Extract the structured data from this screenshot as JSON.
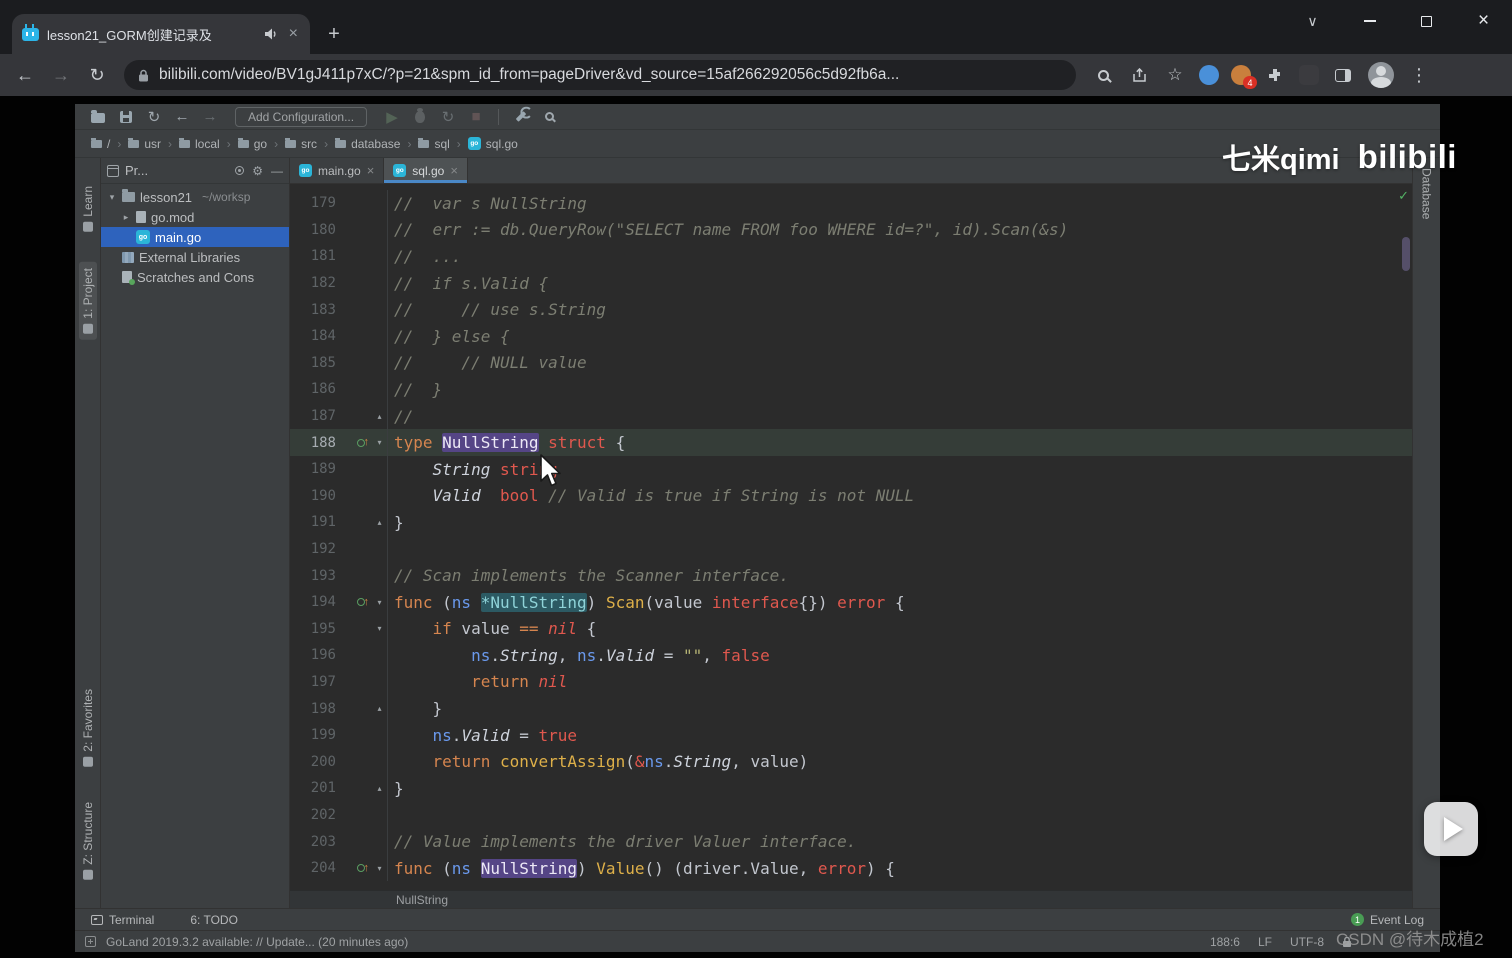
{
  "glyphs": {
    "close": "×",
    "plus": "+",
    "back": "←",
    "forward": "→",
    "reload": "↻",
    "chevron_down": "∨",
    "star": "☆",
    "menu": "⋮",
    "run": "▶",
    "stop": "■",
    "gear": "⚙",
    "minus": "—",
    "check": "✓",
    "up": "↑",
    "fold_open": "▾",
    "fold_close": "▴",
    "tree_open": "▾",
    "tree_closed": "▸",
    "sep": "›"
  },
  "browser": {
    "tab": {
      "title": "lesson21_GORM创建记录及"
    },
    "url": "bilibili.com/video/BV1gJ411p7xC/?p=21&spm_id_from=pageDriver&vd_source=15af266292056c5d92fb6a...",
    "extension_badge": "4"
  },
  "ide": {
    "toolbar": {
      "add_configuration": "Add Configuration..."
    },
    "breadcrumbs": [
      "/",
      "usr",
      "local",
      "go",
      "src",
      "database",
      "sql",
      "sql.go"
    ],
    "left_stripe": {
      "top": [
        {
          "label": "Learn"
        },
        {
          "label": "1: Project",
          "active": true
        }
      ],
      "bottom": [
        {
          "label": "2: Favorites"
        },
        {
          "label": "Z: Structure"
        }
      ]
    },
    "right_stripe": {
      "label": "Database"
    },
    "project": {
      "header": "Pr...",
      "items": [
        {
          "label": "lesson21",
          "suffix": "~/worksp",
          "arrow": "open",
          "icon": "folder",
          "indent": 0
        },
        {
          "label": "go.mod",
          "arrow": "closed",
          "icon": "file",
          "indent": 1
        },
        {
          "label": "main.go",
          "icon": "go",
          "indent": 1,
          "selected": true
        },
        {
          "label": "External Libraries",
          "icon": "lib",
          "indent": 0
        },
        {
          "label": "Scratches and Cons",
          "icon": "scratch",
          "indent": 0
        }
      ]
    },
    "tabs": [
      {
        "label": "main.go"
      },
      {
        "label": "sql.go",
        "active": true
      }
    ],
    "editor": {
      "breadcrumb": "NullString",
      "lines": [
        {
          "n": 179,
          "seg": [
            [
              "c",
              "//  var s NullString"
            ]
          ]
        },
        {
          "n": 180,
          "seg": [
            [
              "c",
              "//  err := db.QueryRow(\"SELECT name FROM foo WHERE id=?\", id).Scan(&s)"
            ]
          ]
        },
        {
          "n": 181,
          "seg": [
            [
              "c",
              "//  ..."
            ]
          ]
        },
        {
          "n": 182,
          "seg": [
            [
              "c",
              "//  if s.Valid {"
            ]
          ]
        },
        {
          "n": 183,
          "seg": [
            [
              "c",
              "//     // use s.String"
            ]
          ]
        },
        {
          "n": 184,
          "seg": [
            [
              "c",
              "//  } else {"
            ]
          ]
        },
        {
          "n": 185,
          "seg": [
            [
              "c",
              "//     // NULL value"
            ]
          ]
        },
        {
          "n": 186,
          "seg": [
            [
              "c",
              "//  }"
            ]
          ]
        },
        {
          "n": 187,
          "fold": "^",
          "seg": [
            [
              "c",
              "//"
            ]
          ]
        },
        {
          "n": 188,
          "cur": true,
          "icon": true,
          "fold": "v",
          "seg": [
            [
              "k",
              "type"
            ],
            [
              "p",
              " "
            ],
            [
              "hp",
              "NullString"
            ],
            [
              "p",
              " "
            ],
            [
              "t",
              "struct"
            ],
            [
              "p",
              " {"
            ]
          ]
        },
        {
          "n": 189,
          "seg": [
            [
              "p",
              "    "
            ],
            [
              "i",
              "String"
            ],
            [
              "p",
              " "
            ],
            [
              "t",
              "string"
            ]
          ]
        },
        {
          "n": 190,
          "seg": [
            [
              "p",
              "    "
            ],
            [
              "i",
              "Valid"
            ],
            [
              "p",
              "  "
            ],
            [
              "t",
              "bool"
            ],
            [
              "p",
              " "
            ],
            [
              "c",
              "// Valid is true if String is not NULL"
            ]
          ]
        },
        {
          "n": 191,
          "fold": "^",
          "seg": [
            [
              "p",
              "}"
            ]
          ]
        },
        {
          "n": 192,
          "seg": []
        },
        {
          "n": 193,
          "seg": [
            [
              "c",
              "// Scan implements the Scanner interface."
            ]
          ]
        },
        {
          "n": 194,
          "icon": true,
          "fold": "v",
          "seg": [
            [
              "k",
              "func"
            ],
            [
              "p",
              " ("
            ],
            [
              "r",
              "ns"
            ],
            [
              "p",
              " "
            ],
            [
              "ht",
              "*NullString"
            ],
            [
              "p",
              ") "
            ],
            [
              "f",
              "Scan"
            ],
            [
              "p",
              "(value "
            ],
            [
              "t",
              "interface"
            ],
            [
              "p",
              "{}) "
            ],
            [
              "t",
              "error"
            ],
            [
              "p",
              " {"
            ]
          ]
        },
        {
          "n": 195,
          "fold": "v",
          "seg": [
            [
              "p",
              "    "
            ],
            [
              "k",
              "if"
            ],
            [
              "p",
              " value "
            ],
            [
              "k",
              "=="
            ],
            [
              "p",
              " "
            ],
            [
              "n",
              "nil"
            ],
            [
              "p",
              " {"
            ]
          ]
        },
        {
          "n": 196,
          "seg": [
            [
              "p",
              "        "
            ],
            [
              "r",
              "ns"
            ],
            [
              "p",
              "."
            ],
            [
              "i",
              "String"
            ],
            [
              "p",
              ", "
            ],
            [
              "r",
              "ns"
            ],
            [
              "p",
              "."
            ],
            [
              "i",
              "Valid"
            ],
            [
              "p",
              " = "
            ],
            [
              "s",
              "\"\""
            ],
            [
              "p",
              ", "
            ],
            [
              "t",
              "false"
            ]
          ]
        },
        {
          "n": 197,
          "seg": [
            [
              "p",
              "        "
            ],
            [
              "k",
              "return"
            ],
            [
              "p",
              " "
            ],
            [
              "n",
              "nil"
            ]
          ]
        },
        {
          "n": 198,
          "fold": "^",
          "seg": [
            [
              "p",
              "    }"
            ]
          ]
        },
        {
          "n": 199,
          "seg": [
            [
              "p",
              "    "
            ],
            [
              "r",
              "ns"
            ],
            [
              "p",
              "."
            ],
            [
              "i",
              "Valid"
            ],
            [
              "p",
              " = "
            ],
            [
              "t",
              "true"
            ]
          ]
        },
        {
          "n": 200,
          "seg": [
            [
              "p",
              "    "
            ],
            [
              "k",
              "return"
            ],
            [
              "p",
              " "
            ],
            [
              "f",
              "convertAssign"
            ],
            [
              "p",
              "("
            ],
            [
              "t",
              "&"
            ],
            [
              "r",
              "ns"
            ],
            [
              "p",
              "."
            ],
            [
              "i",
              "String"
            ],
            [
              "p",
              ", value)"
            ]
          ]
        },
        {
          "n": 201,
          "fold": "^",
          "seg": [
            [
              "p",
              "}"
            ]
          ]
        },
        {
          "n": 202,
          "seg": []
        },
        {
          "n": 203,
          "seg": [
            [
              "c",
              "// Value implements the driver Valuer interface."
            ]
          ]
        },
        {
          "n": 204,
          "icon": true,
          "fold": "v",
          "seg": [
            [
              "k",
              "func"
            ],
            [
              "p",
              " ("
            ],
            [
              "r",
              "ns"
            ],
            [
              "p",
              " "
            ],
            [
              "hp",
              "NullString"
            ],
            [
              "p",
              ") "
            ],
            [
              "f",
              "Value"
            ],
            [
              "p",
              "() (driver.Value, "
            ],
            [
              "t",
              "error"
            ],
            [
              "p",
              ") {"
            ]
          ]
        }
      ]
    },
    "status_tools": {
      "terminal": "Terminal",
      "todo": "6: TODO",
      "event_count": "1",
      "event_log": "Event Log"
    },
    "status": {
      "message": "GoLand 2019.3.2 available: // Update... (20 minutes ago)",
      "caret": "188:6",
      "line_ending": "LF",
      "encoding": "UTF-8"
    }
  },
  "overlays": {
    "qimi": "七米qimi",
    "bili": "bilibili",
    "csdn": "CSDN @待木成植2"
  }
}
